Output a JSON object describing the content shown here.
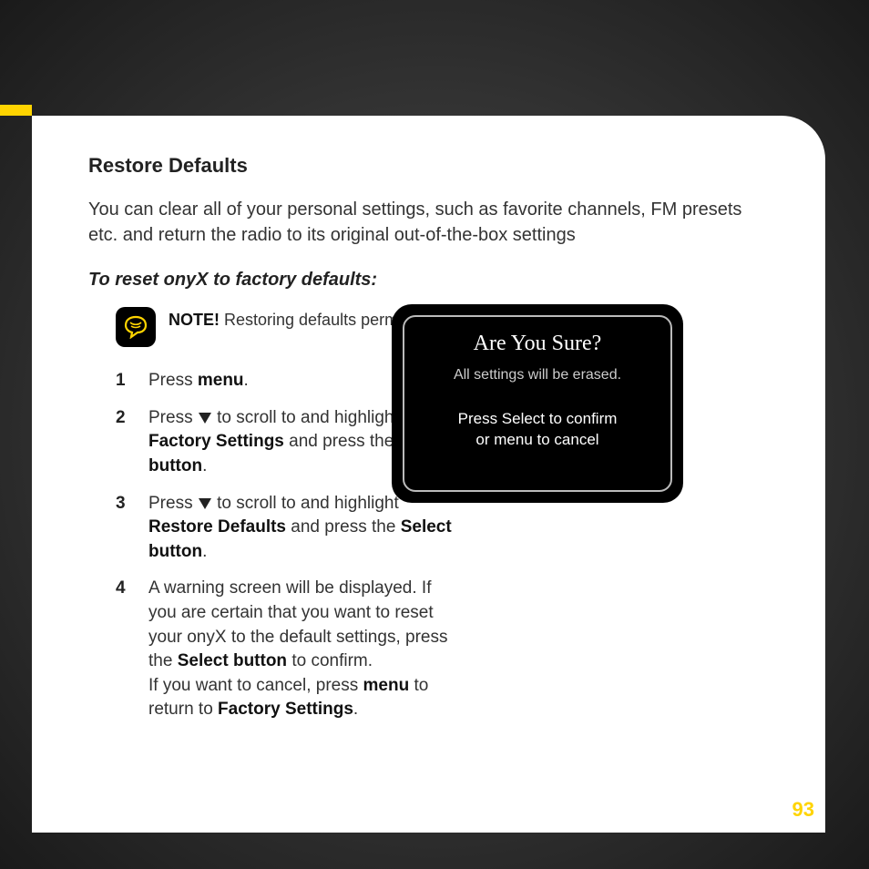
{
  "title": "Restore Defaults",
  "intro": "You can clear all of your personal settings, such as favorite channels, FM presets etc. and return the radio to its original out-of-the-box settings",
  "subhead": "To reset onyX to factory defaults:",
  "note_label": "NOTE!",
  "note_text": " Restoring defaults permanently removes all personal settings.",
  "steps": {
    "n1": "1",
    "s1_a": "Press ",
    "s1_b": "menu",
    "s1_c": ".",
    "n2": "2",
    "s2_a": "Press ",
    "s2_b": " to scroll to and highlight ",
    "s2_c": "Factory Settings",
    "s2_d": " and press the ",
    "s2_e": "Select button",
    "s2_f": ".",
    "n3": "3",
    "s3_a": "Press ",
    "s3_b": " to scroll to and highlight ",
    "s3_c": "Restore Defaults",
    "s3_d": " and press the ",
    "s3_e": "Select button",
    "s3_f": ".",
    "n4": "4",
    "s4_a": "A warning screen will be displayed. If you are certain that you want to reset your onyX to the default settings, press the ",
    "s4_b": "Select button",
    "s4_c": " to confirm.",
    "s4_d": "If you want to cancel, press ",
    "s4_e": "menu",
    "s4_f": " to return to ",
    "s4_g": "Factory Settings",
    "s4_h": "."
  },
  "screen": {
    "title": "Are You Sure?",
    "sub": "All settings will be erased.",
    "press1": "Press Select to confirm",
    "press2": "or menu to cancel"
  },
  "page_number": "93"
}
